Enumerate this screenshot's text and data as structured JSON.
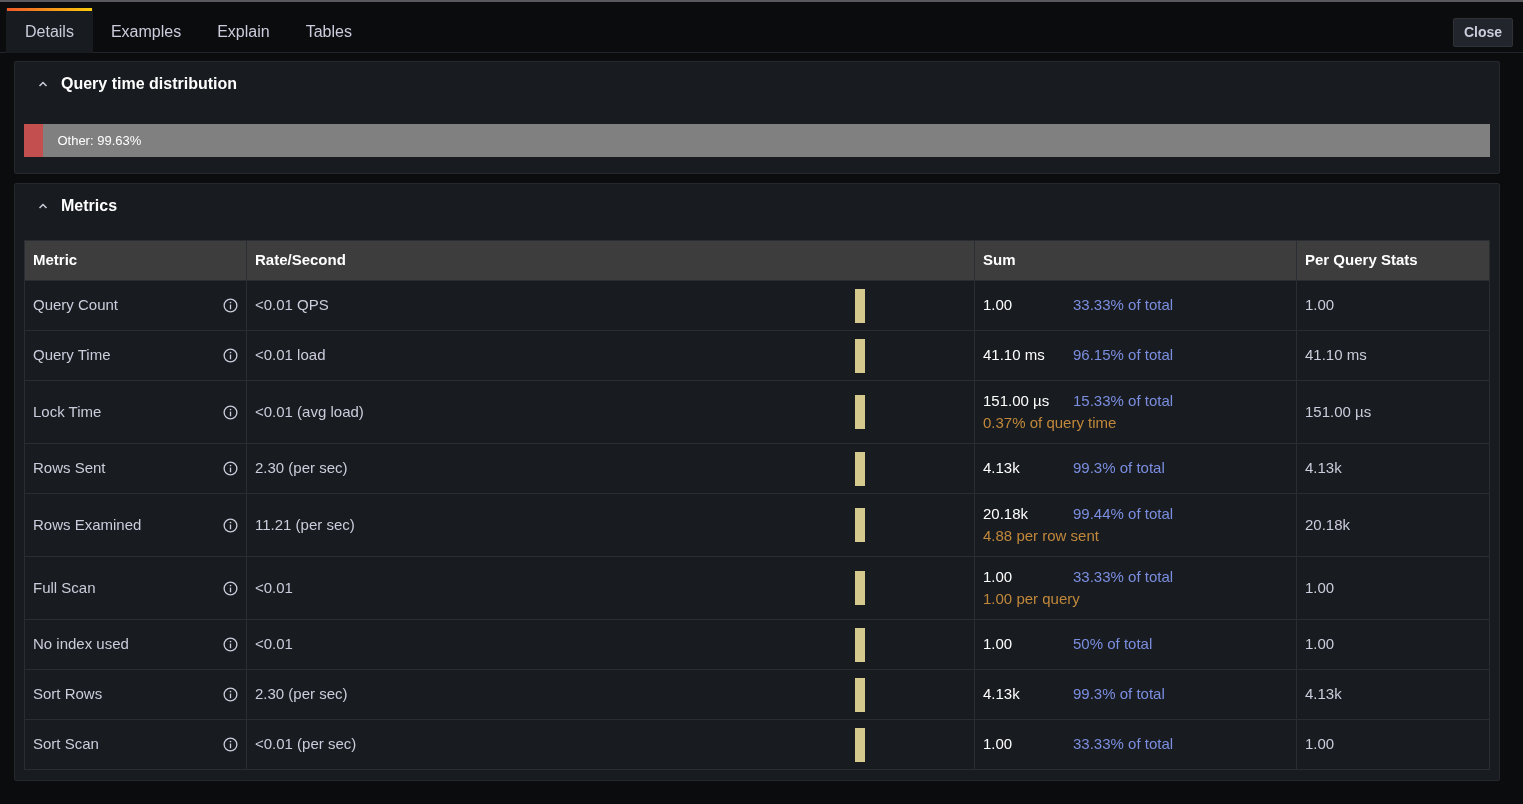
{
  "tabs": [
    {
      "label": "Details",
      "selected": true
    },
    {
      "label": "Examples",
      "selected": false
    },
    {
      "label": "Explain",
      "selected": false
    },
    {
      "label": "Tables",
      "selected": false
    }
  ],
  "close_button": "Close",
  "distribution": {
    "title": "Query time distribution",
    "expanded": true,
    "label": "Other: 99.63%",
    "level": 0.9963
  },
  "metrics": {
    "title": "Metrics",
    "expanded": true,
    "columns": [
      "Metric",
      "Rate/Second",
      "Sum",
      "Per Query Stats"
    ],
    "rows": [
      {
        "metric": "Query Count",
        "rate": "<0.01 QPS",
        "sum": "1.00",
        "share": "33.33% of total",
        "per_query": "1.00"
      },
      {
        "metric": "Query Time",
        "rate": "<0.01 load",
        "sum": "41.10 ms",
        "share": "96.15% of total",
        "per_query": "41.10 ms"
      },
      {
        "metric": "Lock Time",
        "rate": "<0.01 (avg load)",
        "sum": "151.00 µs",
        "share": "15.33% of total",
        "note": "0.37% of query time",
        "per_query": "151.00 µs"
      },
      {
        "metric": "Rows Sent",
        "rate": "2.30 (per sec)",
        "sum": "4.13k",
        "share": "99.3% of total",
        "per_query": "4.13k"
      },
      {
        "metric": "Rows Examined",
        "rate": "11.21 (per sec)",
        "sum": "20.18k",
        "share": "99.44% of total",
        "note": "4.88 per row sent",
        "per_query": "20.18k"
      },
      {
        "metric": "Full Scan",
        "rate": "<0.01",
        "sum": "1.00",
        "share": "33.33% of total",
        "note": "1.00 per query",
        "per_query": "1.00"
      },
      {
        "metric": "No index used",
        "rate": "<0.01",
        "sum": "1.00",
        "share": "50% of total",
        "per_query": "1.00"
      },
      {
        "metric": "Sort Rows",
        "rate": "2.30 (per sec)",
        "sum": "4.13k",
        "share": "99.3% of total",
        "per_query": "4.13k"
      },
      {
        "metric": "Sort Scan",
        "rate": "<0.01 (per sec)",
        "sum": "1.00",
        "share": "33.33% of total",
        "per_query": "1.00"
      }
    ]
  }
}
